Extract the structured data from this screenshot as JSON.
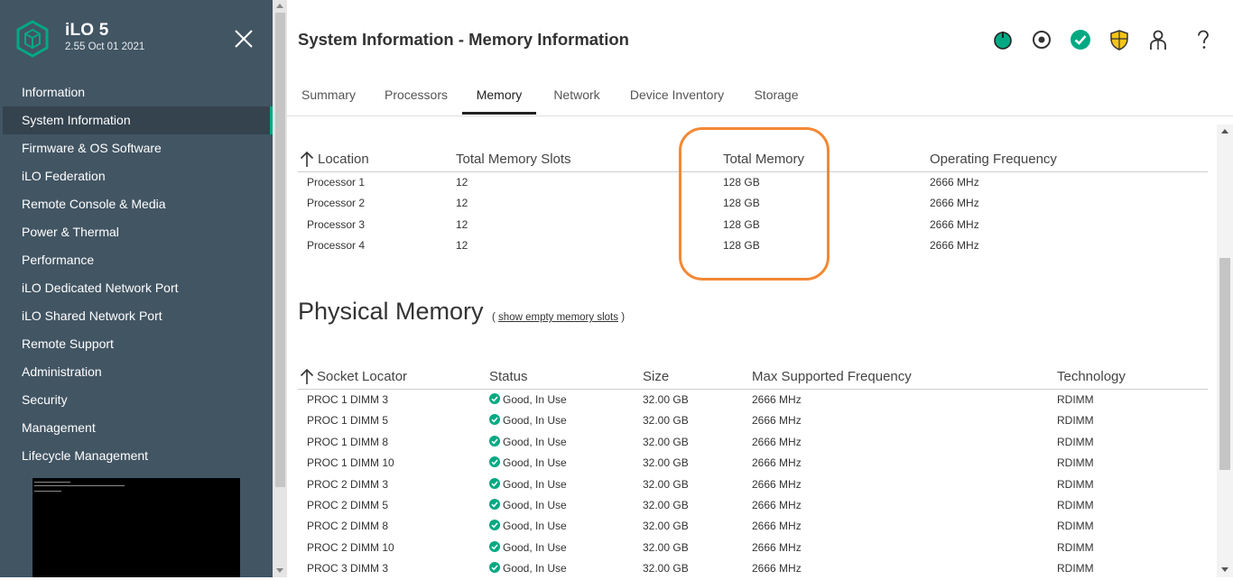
{
  "sidebar": {
    "product": "iLO 5",
    "version": "2.55 Oct 01 2021",
    "items": [
      {
        "label": "Information",
        "active": false
      },
      {
        "label": "System Information",
        "active": true
      },
      {
        "label": "Firmware & OS Software",
        "active": false
      },
      {
        "label": "iLO Federation",
        "active": false
      },
      {
        "label": "Remote Console & Media",
        "active": false
      },
      {
        "label": "Power & Thermal",
        "active": false
      },
      {
        "label": "Performance",
        "active": false
      },
      {
        "label": "iLO Dedicated Network Port",
        "active": false
      },
      {
        "label": "iLO Shared Network Port",
        "active": false
      },
      {
        "label": "Remote Support",
        "active": false
      },
      {
        "label": "Administration",
        "active": false
      },
      {
        "label": "Security",
        "active": false
      },
      {
        "label": "Management",
        "active": false
      },
      {
        "label": "Lifecycle Management",
        "active": false
      }
    ]
  },
  "header": {
    "title": "System Information - Memory Information",
    "icons": [
      "power-icon",
      "locator-icon",
      "health-ok-icon",
      "security-shield-icon",
      "user-icon",
      "help-icon"
    ]
  },
  "tabs": [
    {
      "label": "Summary",
      "active": false
    },
    {
      "label": "Processors",
      "active": false
    },
    {
      "label": "Memory",
      "active": true
    },
    {
      "label": "Network",
      "active": false
    },
    {
      "label": "Device Inventory",
      "active": false
    },
    {
      "label": "Storage",
      "active": false
    }
  ],
  "memory_summary": {
    "columns": [
      "Location",
      "Total Memory Slots",
      "Total Memory",
      "Operating Frequency"
    ],
    "rows": [
      [
        "Processor 1",
        "12",
        "128 GB",
        "2666 MHz"
      ],
      [
        "Processor 2",
        "12",
        "128 GB",
        "2666 MHz"
      ],
      [
        "Processor 3",
        "12",
        "128 GB",
        "2666 MHz"
      ],
      [
        "Processor 4",
        "12",
        "128 GB",
        "2666 MHz"
      ]
    ]
  },
  "physical_memory": {
    "title": "Physical Memory",
    "open_paren": "(",
    "link_label": "show empty memory slots",
    "close_paren": ")",
    "columns": [
      "Socket Locator",
      "Status",
      "Size",
      "Max Supported Frequency",
      "Technology"
    ],
    "rows": [
      [
        "PROC 1 DIMM 3",
        "Good, In Use",
        "32.00 GB",
        "2666 MHz",
        "RDIMM"
      ],
      [
        "PROC 1 DIMM 5",
        "Good, In Use",
        "32.00 GB",
        "2666 MHz",
        "RDIMM"
      ],
      [
        "PROC 1 DIMM 8",
        "Good, In Use",
        "32.00 GB",
        "2666 MHz",
        "RDIMM"
      ],
      [
        "PROC 1 DIMM 10",
        "Good, In Use",
        "32.00 GB",
        "2666 MHz",
        "RDIMM"
      ],
      [
        "PROC 2 DIMM 3",
        "Good, In Use",
        "32.00 GB",
        "2666 MHz",
        "RDIMM"
      ],
      [
        "PROC 2 DIMM 5",
        "Good, In Use",
        "32.00 GB",
        "2666 MHz",
        "RDIMM"
      ],
      [
        "PROC 2 DIMM 8",
        "Good, In Use",
        "32.00 GB",
        "2666 MHz",
        "RDIMM"
      ],
      [
        "PROC 2 DIMM 10",
        "Good, In Use",
        "32.00 GB",
        "2666 MHz",
        "RDIMM"
      ],
      [
        "PROC 3 DIMM 3",
        "Good, In Use",
        "32.00 GB",
        "2666 MHz",
        "RDIMM"
      ]
    ]
  },
  "colors": {
    "sidebar_bg": "#425563",
    "accent_green": "#01a982",
    "highlight_orange": "#f38834",
    "shield_yellow": "#f5c518"
  }
}
